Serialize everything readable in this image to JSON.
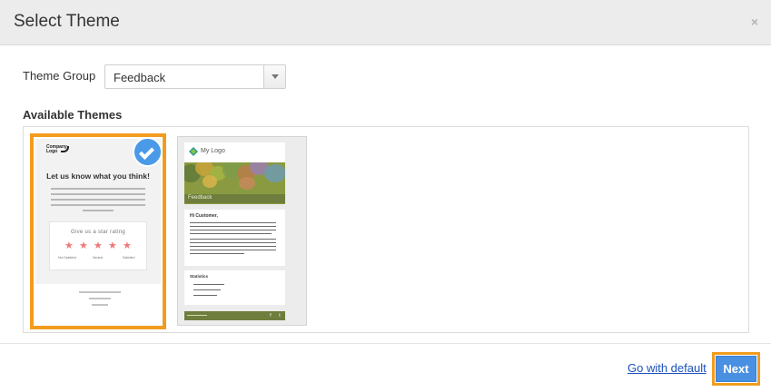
{
  "dialog": {
    "title": "Select Theme",
    "close_glyph": "×"
  },
  "theme_group": {
    "label": "Theme Group",
    "selected": "Feedback"
  },
  "available": {
    "heading": "Available Themes"
  },
  "themes": [
    {
      "selected": true,
      "logo_text": "Company Logo",
      "heading": "Let us know what you think!",
      "card_title": "Give us a star rating",
      "stars": 5,
      "scale_labels": [
        "Not Satisfied",
        "Neutral",
        "Satisfied"
      ],
      "colors": {
        "border": "#f29c1f",
        "check": "#4a9ae8",
        "star": "#f07878"
      }
    },
    {
      "selected": false,
      "logo_text": "My Logo",
      "banner_label": "Feedback",
      "greeting": "Hi Customer,",
      "box_title": "Statistics",
      "colors": {
        "banner": "#6f7e3d"
      }
    }
  ],
  "footer": {
    "go_default": "Go with default",
    "next": "Next"
  },
  "colors": {
    "accent": "#4a90e2",
    "highlight": "#f29c1f",
    "link": "#1a4fbf",
    "header_bg": "#ececec"
  }
}
